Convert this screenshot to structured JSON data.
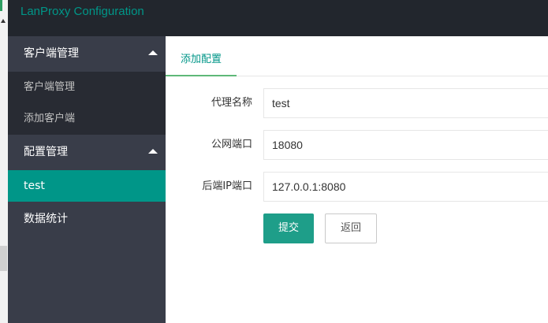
{
  "header": {
    "title": "LanProxy Configuration"
  },
  "sidebar": {
    "groups": [
      {
        "label": "客户端管理",
        "items": [
          {
            "label": "客户端管理"
          },
          {
            "label": "添加客户端"
          }
        ]
      },
      {
        "label": "配置管理",
        "items": [
          {
            "label": "test"
          }
        ]
      },
      {
        "label": "数据统计"
      }
    ]
  },
  "main": {
    "tab": "添加配置",
    "form": {
      "name": {
        "label": "代理名称",
        "value": "test"
      },
      "port": {
        "label": "公网端口",
        "value": "18080"
      },
      "backend": {
        "label": "后端IP端口",
        "value": "127.0.0.1:8080"
      }
    },
    "submit_label": "提交",
    "back_label": "返回"
  },
  "colors": {
    "accent": "#009688",
    "header_bg": "#22262d",
    "sidebar_bg": "#393d49",
    "submenu_bg": "#282b33"
  }
}
